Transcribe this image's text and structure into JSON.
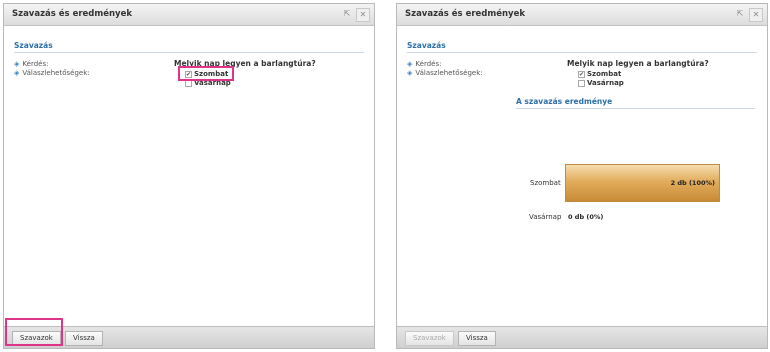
{
  "left_panel": {
    "title": "Szavazás és eredmények",
    "section": "Szavazás",
    "question_label": "Kérdés:",
    "options_label": "Válaszlehetőségek:",
    "question": "Melyik nap legyen a barlangtúra?",
    "options": [
      {
        "label": "Szombat",
        "checked": true
      },
      {
        "label": "Vasárnap",
        "checked": false
      }
    ],
    "buttons": {
      "vote": "Szavazok",
      "back": "Vissza"
    }
  },
  "right_panel": {
    "title": "Szavazás és eredmények",
    "section": "Szavazás",
    "question_label": "Kérdés:",
    "options_label": "Válaszlehetőségek:",
    "question": "Melyik nap legyen a barlangtúra?",
    "options": [
      {
        "label": "Szombat",
        "checked": true
      },
      {
        "label": "Vasárnap",
        "checked": false
      }
    ],
    "results_title": "A szavazás eredménye",
    "buttons": {
      "vote": "Szavazok",
      "back": "Vissza"
    }
  },
  "chart_data": {
    "type": "bar",
    "orientation": "horizontal",
    "categories": [
      "Szombat",
      "Vasárnap"
    ],
    "values": [
      2,
      0
    ],
    "percent": [
      100,
      0
    ],
    "value_labels": [
      "2 db (100%)",
      "0 db (0%)"
    ]
  },
  "colors": {
    "highlight": "#e0338a",
    "accent": "#2c6fa8",
    "bar": "#e2ad5d"
  }
}
